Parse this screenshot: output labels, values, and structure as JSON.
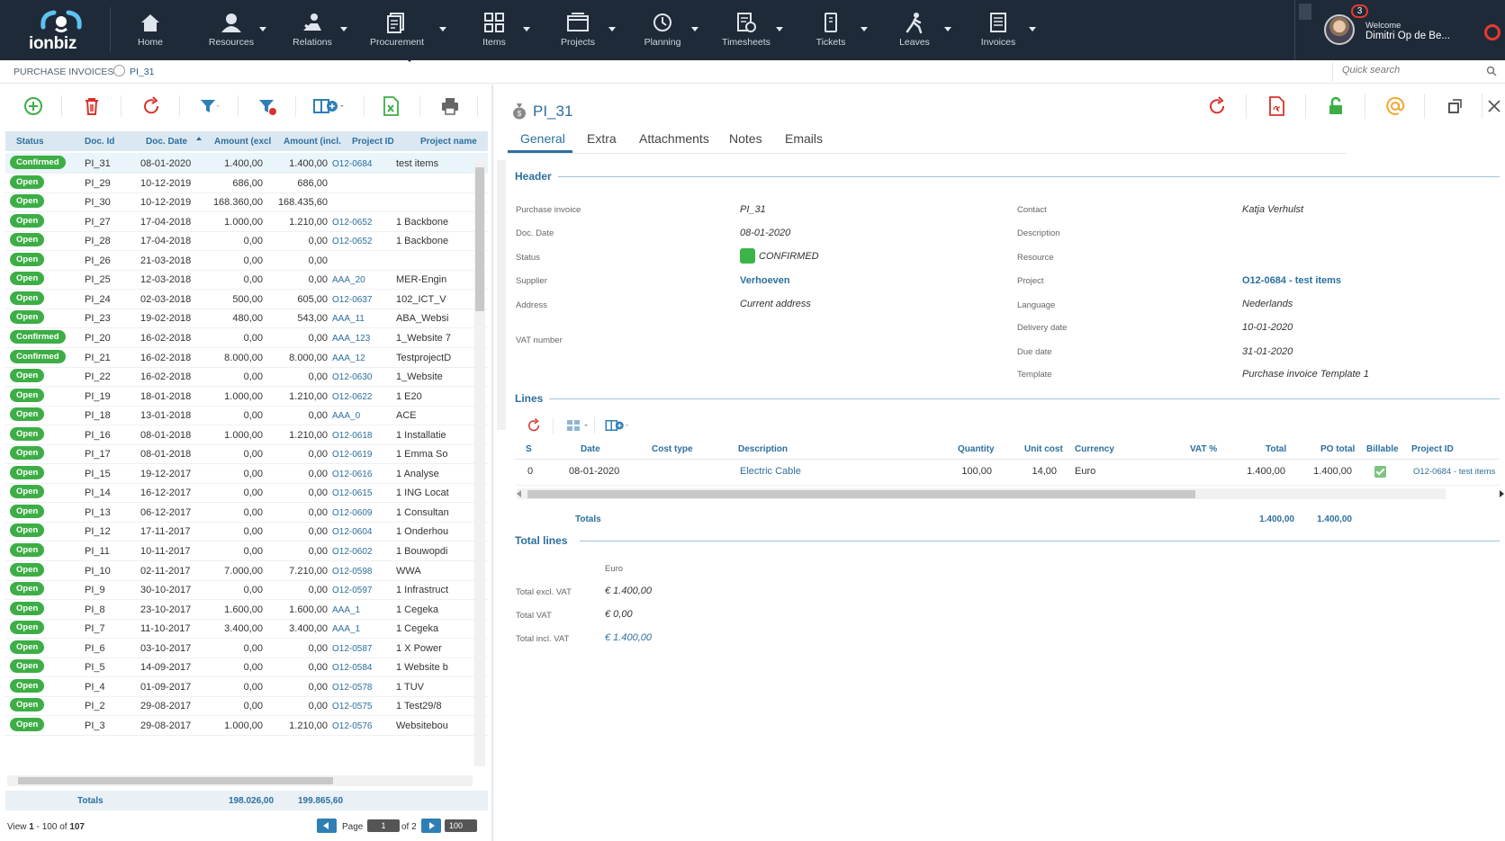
{
  "app": {
    "logo_text": "ionbiz",
    "nav": [
      {
        "label": "Home",
        "icon": "home-icon"
      },
      {
        "label": "Resources",
        "icon": "resources-icon"
      },
      {
        "label": "Relations",
        "icon": "relations-icon"
      },
      {
        "label": "Procurement",
        "icon": "procurement-icon"
      },
      {
        "label": "Items",
        "icon": "items-icon"
      },
      {
        "label": "Projects",
        "icon": "projects-icon"
      },
      {
        "label": "Planning",
        "icon": "planning-icon"
      },
      {
        "label": "Timesheets",
        "icon": "timesheets-icon"
      },
      {
        "label": "Tickets",
        "icon": "tickets-icon"
      },
      {
        "label": "Leaves",
        "icon": "leaves-icon"
      },
      {
        "label": "Invoices",
        "icon": "invoices-icon"
      }
    ],
    "user": {
      "welcome": "Welcome",
      "name": "Dimitri Op de Be...",
      "notifications": "3"
    }
  },
  "breadcrumb": {
    "section": "PURCHASE INVOICES",
    "current": "PI_31"
  },
  "search": {
    "placeholder": "Quick search"
  },
  "grid": {
    "columns": [
      "Status",
      "Doc. Id",
      "Doc. Date",
      "Amount (excl",
      "Amount (incl.",
      "Project ID",
      "Project name"
    ],
    "rows": [
      {
        "status": "Confirmed",
        "id": "PI_31",
        "date": "08-01-2020",
        "excl": "1.400,00",
        "incl": "1.400,00",
        "pid": "O12-0684",
        "pname": "test items"
      },
      {
        "status": "Open",
        "id": "PI_29",
        "date": "10-12-2019",
        "excl": "686,00",
        "incl": "686,00",
        "pid": "",
        "pname": ""
      },
      {
        "status": "Open",
        "id": "PI_30",
        "date": "10-12-2019",
        "excl": "168.360,00",
        "incl": "168.435,60",
        "pid": "",
        "pname": ""
      },
      {
        "status": "Open",
        "id": "PI_27",
        "date": "17-04-2018",
        "excl": "1.000,00",
        "incl": "1.210,00",
        "pid": "O12-0652",
        "pname": "1 Backbone"
      },
      {
        "status": "Open",
        "id": "PI_28",
        "date": "17-04-2018",
        "excl": "0,00",
        "incl": "0,00",
        "pid": "O12-0652",
        "pname": "1 Backbone"
      },
      {
        "status": "Open",
        "id": "PI_26",
        "date": "21-03-2018",
        "excl": "0,00",
        "incl": "0,00",
        "pid": "",
        "pname": ""
      },
      {
        "status": "Open",
        "id": "PI_25",
        "date": "12-03-2018",
        "excl": "0,00",
        "incl": "0,00",
        "pid": "AAA_20",
        "pname": "MER-Engin"
      },
      {
        "status": "Open",
        "id": "PI_24",
        "date": "02-03-2018",
        "excl": "500,00",
        "incl": "605,00",
        "pid": "O12-0637",
        "pname": "102_ICT_V"
      },
      {
        "status": "Open",
        "id": "PI_23",
        "date": "19-02-2018",
        "excl": "480,00",
        "incl": "543,00",
        "pid": "AAA_11",
        "pname": "ABA_Websi"
      },
      {
        "status": "Confirmed",
        "id": "PI_20",
        "date": "16-02-2018",
        "excl": "0,00",
        "incl": "0,00",
        "pid": "AAA_123",
        "pname": "1_Website 7"
      },
      {
        "status": "Confirmed",
        "id": "PI_21",
        "date": "16-02-2018",
        "excl": "8.000,00",
        "incl": "8.000,00",
        "pid": "AAA_12",
        "pname": "TestprojectD"
      },
      {
        "status": "Open",
        "id": "PI_22",
        "date": "16-02-2018",
        "excl": "0,00",
        "incl": "0,00",
        "pid": "O12-0630",
        "pname": "1_Website"
      },
      {
        "status": "Open",
        "id": "PI_19",
        "date": "18-01-2018",
        "excl": "1.000,00",
        "incl": "1.210,00",
        "pid": "O12-0622",
        "pname": "1 E20"
      },
      {
        "status": "Open",
        "id": "PI_18",
        "date": "13-01-2018",
        "excl": "0,00",
        "incl": "0,00",
        "pid": "AAA_0",
        "pname": "ACE"
      },
      {
        "status": "Open",
        "id": "PI_16",
        "date": "08-01-2018",
        "excl": "1.000,00",
        "incl": "1.210,00",
        "pid": "O12-0618",
        "pname": "1 Installatie"
      },
      {
        "status": "Open",
        "id": "PI_17",
        "date": "08-01-2018",
        "excl": "0,00",
        "incl": "0,00",
        "pid": "O12-0619",
        "pname": "1 Emma So"
      },
      {
        "status": "Open",
        "id": "PI_15",
        "date": "19-12-2017",
        "excl": "0,00",
        "incl": "0,00",
        "pid": "O12-0616",
        "pname": "1 Analyse"
      },
      {
        "status": "Open",
        "id": "PI_14",
        "date": "16-12-2017",
        "excl": "0,00",
        "incl": "0,00",
        "pid": "O12-0615",
        "pname": "1 ING Locat"
      },
      {
        "status": "Open",
        "id": "PI_13",
        "date": "06-12-2017",
        "excl": "0,00",
        "incl": "0,00",
        "pid": "O12-0609",
        "pname": "1 Consultan"
      },
      {
        "status": "Open",
        "id": "PI_12",
        "date": "17-11-2017",
        "excl": "0,00",
        "incl": "0,00",
        "pid": "O12-0604",
        "pname": "1 Onderhou"
      },
      {
        "status": "Open",
        "id": "PI_11",
        "date": "10-11-2017",
        "excl": "0,00",
        "incl": "0,00",
        "pid": "O12-0602",
        "pname": "1 Bouwopdi"
      },
      {
        "status": "Open",
        "id": "PI_10",
        "date": "02-11-2017",
        "excl": "7.000,00",
        "incl": "7.210,00",
        "pid": "O12-0598",
        "pname": "WWA"
      },
      {
        "status": "Open",
        "id": "PI_9",
        "date": "30-10-2017",
        "excl": "0,00",
        "incl": "0,00",
        "pid": "O12-0597",
        "pname": "1 Infrastruct"
      },
      {
        "status": "Open",
        "id": "PI_8",
        "date": "23-10-2017",
        "excl": "1.600,00",
        "incl": "1.600,00",
        "pid": "AAA_1",
        "pname": "1 Cegeka"
      },
      {
        "status": "Open",
        "id": "PI_7",
        "date": "11-10-2017",
        "excl": "3.400,00",
        "incl": "3.400,00",
        "pid": "AAA_1",
        "pname": "1 Cegeka"
      },
      {
        "status": "Open",
        "id": "PI_6",
        "date": "03-10-2017",
        "excl": "0,00",
        "incl": "0,00",
        "pid": "O12-0587",
        "pname": "1 X Power"
      },
      {
        "status": "Open",
        "id": "PI_5",
        "date": "14-09-2017",
        "excl": "0,00",
        "incl": "0,00",
        "pid": "O12-0584",
        "pname": "1 Website b"
      },
      {
        "status": "Open",
        "id": "PI_4",
        "date": "01-09-2017",
        "excl": "0,00",
        "incl": "0,00",
        "pid": "O12-0578",
        "pname": "1 TUV"
      },
      {
        "status": "Open",
        "id": "PI_2",
        "date": "29-08-2017",
        "excl": "0,00",
        "incl": "0,00",
        "pid": "O12-0575",
        "pname": "1 Test29/8"
      },
      {
        "status": "Open",
        "id": "PI_3",
        "date": "29-08-2017",
        "excl": "1.000,00",
        "incl": "1.210,00",
        "pid": "O12-0576",
        "pname": "Websitebou"
      }
    ],
    "totals": {
      "label": "Totals",
      "excl": "198.026,00",
      "incl": "199.865,60"
    },
    "pager": {
      "view_prefix": "View ",
      "view_from": "1",
      "view_mid": " - 100 of ",
      "view_total": "107",
      "page_label": "Page",
      "page": "1",
      "of_label": "of 2",
      "page_size": "100"
    }
  },
  "detail": {
    "title": "PI_31",
    "tabs": [
      "General",
      "Extra",
      "Attachments",
      "Notes",
      "Emails"
    ],
    "header_title": "Header",
    "fields_left": [
      {
        "label": "Purchase invoice",
        "value": "PI_31"
      },
      {
        "label": "Doc. Date",
        "value": "08-01-2020"
      },
      {
        "label": "Status",
        "value": "CONFIRMED"
      },
      {
        "label": "Supplier",
        "value": "Verhoeven"
      },
      {
        "label": "Address",
        "value": "Current address"
      },
      {
        "label": "VAT number",
        "value": ""
      }
    ],
    "fields_right": [
      {
        "label": "Contact",
        "value": "Katja Verhulst"
      },
      {
        "label": "Description",
        "value": ""
      },
      {
        "label": "Resource",
        "value": ""
      },
      {
        "label": "Project",
        "value": "O12-0684 - test items"
      },
      {
        "label": "Language",
        "value": "Nederlands"
      },
      {
        "label": "Delivery date",
        "value": "10-01-2020"
      },
      {
        "label": "Due date",
        "value": "31-01-2020"
      },
      {
        "label": "Template",
        "value": "Purchase invoice Template 1"
      }
    ],
    "lines_title": "Lines",
    "lines_columns": [
      "S",
      "Date",
      "Cost type",
      "Description",
      "Quantity",
      "Unit cost",
      "Currency",
      "VAT %",
      "Total",
      "PO total",
      "Billable",
      "Project ID"
    ],
    "lines": [
      {
        "s": "0",
        "date": "08-01-2020",
        "cost_type": "",
        "description": "Electric Cable",
        "quantity": "100,00",
        "unit_cost": "14,00",
        "currency": "Euro",
        "vat": "",
        "total": "1.400,00",
        "po_total": "1.400,00",
        "project": "O12-0684 - test items"
      }
    ],
    "lines_totals": {
      "label": "Totals",
      "total": "1.400,00",
      "po_total": "1.400,00"
    },
    "total_lines_title": "Total lines",
    "total_lines_currency": "Euro",
    "total_lines": [
      {
        "label": "Total excl. VAT",
        "value": "€ 1.400,00"
      },
      {
        "label": "Total VAT",
        "value": "€ 0,00"
      },
      {
        "label": "Total incl. VAT",
        "value": "€ 1.400,00"
      }
    ]
  },
  "colors": {
    "topbar": "#1f2a38",
    "accent": "#2c6f9e",
    "status_green": "#3cae45",
    "danger": "#e63b2e"
  }
}
